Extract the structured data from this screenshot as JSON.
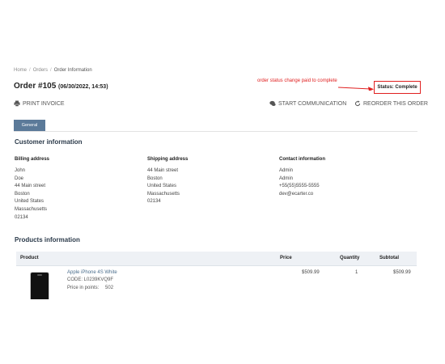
{
  "breadcrumb": [
    "Home",
    "Orders",
    "Order Information"
  ],
  "order": {
    "title": "Order #105",
    "datetime": "(06/30/2022, 14:53)"
  },
  "annotation": "order status change paid to complete",
  "status_label": "Status: Complete",
  "actions": {
    "print": "PRINT INVOICE",
    "communication": "START COMMUNICATION",
    "reorder": "REORDER THIS ORDER"
  },
  "tabs": [
    "General"
  ],
  "customer": {
    "heading": "Customer information",
    "billing": {
      "heading": "Billing address",
      "lines": [
        "John",
        "Doe",
        "44 Main street",
        "Boston",
        "United States",
        "Massachusetts",
        "02134"
      ]
    },
    "shipping": {
      "heading": "Shipping address",
      "lines": [
        "44 Main street",
        "Boston",
        "United States",
        "Massachusetts",
        "02134"
      ]
    },
    "contact": {
      "heading": "Contact information",
      "lines": [
        "Admin",
        "Admin",
        "+55(55)5555-5555",
        "dev@ecarter.co"
      ]
    }
  },
  "products": {
    "heading": "Products information",
    "columns": [
      "Product",
      "Price",
      "Quantity",
      "Subtotal"
    ],
    "rows": [
      {
        "name": "Apple iPhone 4S White",
        "code": "CODE: L0239KVQ9F",
        "points_label": "Price in points:",
        "points": "502",
        "price": "$509.99",
        "quantity": "1",
        "subtotal": "$509.99"
      }
    ]
  },
  "colors": {
    "tab": "#5b7a99",
    "annotation": "#e02020",
    "heading": "#2b3a4a"
  },
  "icons": {
    "print": "printer-icon",
    "communication": "chat-icon",
    "reorder": "refresh-icon"
  }
}
